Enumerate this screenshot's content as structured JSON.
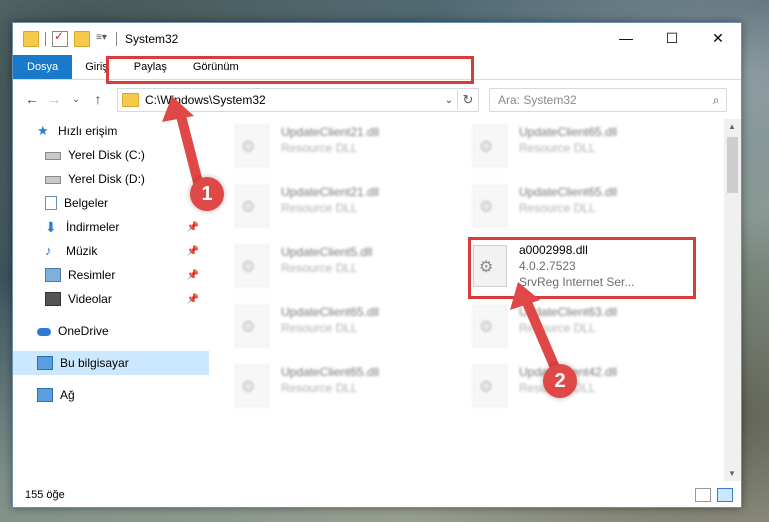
{
  "window": {
    "title": "System32",
    "controls": {
      "minimize": "—",
      "maximize": "☐",
      "close": "✕"
    }
  },
  "ribbon": {
    "tabs": [
      "Dosya",
      "Giriş",
      "Paylaş",
      "Görünüm"
    ]
  },
  "address_bar": {
    "path": "C:\\Windows\\System32",
    "search_placeholder": "Ara: System32"
  },
  "sidebar": {
    "items": [
      {
        "label": "Hızlı erişim",
        "icon": "star-icon"
      },
      {
        "label": "Yerel Disk (C:)",
        "icon": "drive-icon"
      },
      {
        "label": "Yerel Disk (D:)",
        "icon": "drive-icon"
      },
      {
        "label": "Belgeler",
        "icon": "document-icon"
      },
      {
        "label": "İndirmeler",
        "icon": "download-icon"
      },
      {
        "label": "Müzik",
        "icon": "music-icon"
      },
      {
        "label": "Resimler",
        "icon": "pictures-icon"
      },
      {
        "label": "Videolar",
        "icon": "video-icon"
      },
      {
        "label": "OneDrive",
        "icon": "cloud-icon"
      },
      {
        "label": "Bu bilgisayar",
        "icon": "computer-icon"
      },
      {
        "label": "Ağ",
        "icon": "network-icon"
      }
    ]
  },
  "files": [
    {
      "name": "UpdateClient21.dll",
      "desc": "Resource DLL"
    },
    {
      "name": "UpdateClient65.dll",
      "desc": "Resource DLL"
    },
    {
      "name": "UpdateClient21.dll",
      "desc": "Resource DLL"
    },
    {
      "name": "UpdateClient65.dll",
      "desc": "Resource DLL"
    },
    {
      "name": "UpdateClient5.dll",
      "desc": "Resource DLL"
    },
    {
      "name": "a0002998.dll",
      "desc": "4.0.2.7523",
      "desc2": "SrvReg Internet Ser..."
    },
    {
      "name": "UpdateClient65.dll",
      "desc": "Resource DLL"
    },
    {
      "name": "UpdateClient63.dll",
      "desc": "Resource DLL"
    },
    {
      "name": "UpdateClient65.dll",
      "desc": "Resource DLL"
    },
    {
      "name": "UpdateClient42.dll",
      "desc": "Resource DLL"
    }
  ],
  "status": {
    "count": "155 öğe"
  },
  "annotations": {
    "step1": "1",
    "step2": "2"
  },
  "colors": {
    "highlight": "#d93b3b",
    "accent": "#1979ca"
  }
}
